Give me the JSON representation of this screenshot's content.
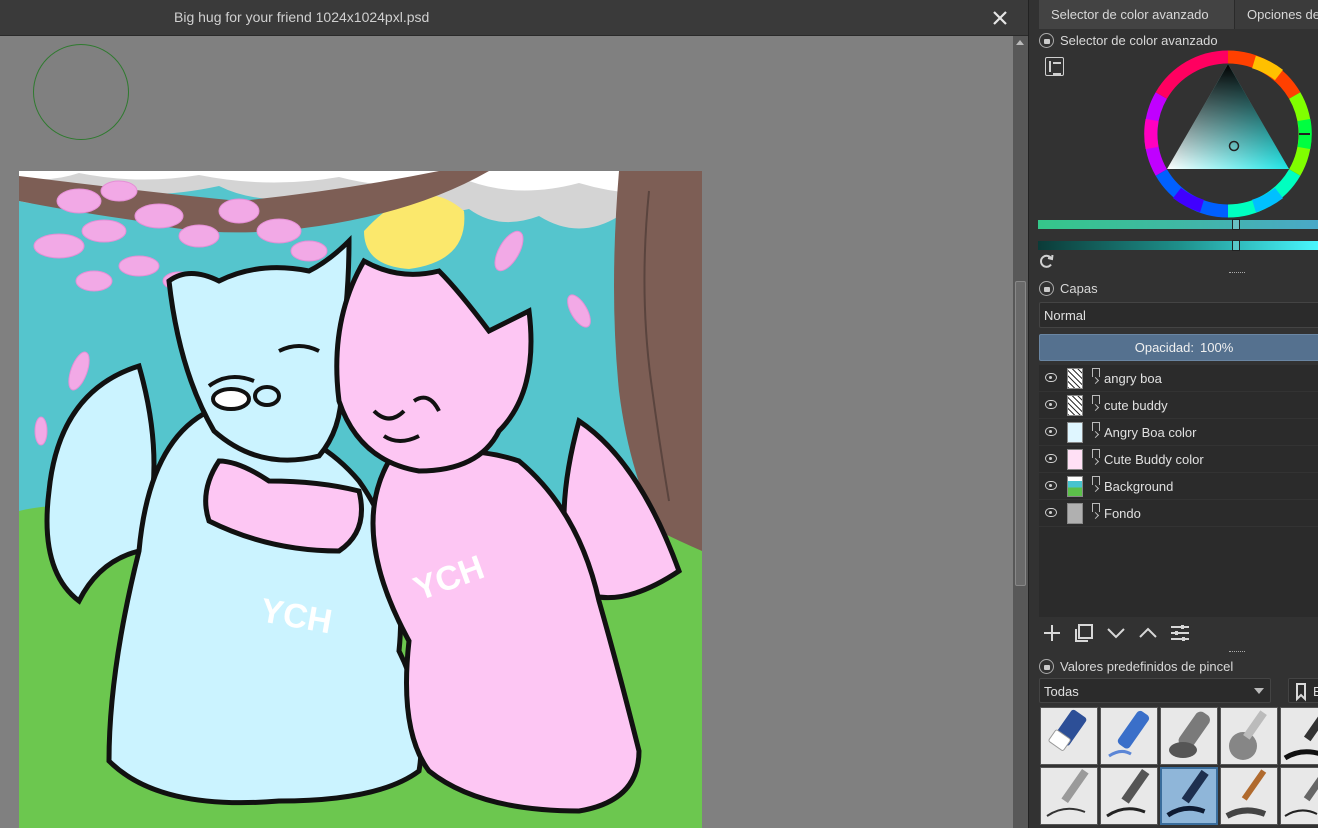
{
  "document": {
    "title": "Big hug for your friend 1024x1024pxl.psd"
  },
  "dock": {
    "tabs": [
      {
        "label": "Selector de color avanzado"
      },
      {
        "label": "Opciones de"
      }
    ],
    "color_selector": {
      "title": "Selector de color avanzado"
    },
    "layers_panel": {
      "title": "Capas",
      "blend_mode": "Normal",
      "opacity_label": "Opacidad:",
      "opacity_value": "100%",
      "layers": [
        {
          "name": "angry boa",
          "thumb": "lines"
        },
        {
          "name": "cute buddy",
          "thumb": "lines"
        },
        {
          "name": "Angry Boa color",
          "thumb": "blue"
        },
        {
          "name": "Cute Buddy color",
          "thumb": "pink"
        },
        {
          "name": "Background",
          "thumb": "bg"
        },
        {
          "name": "Fondo",
          "thumb": "grey"
        }
      ]
    },
    "brush_presets": {
      "title": "Valores predefinidos de pincel",
      "filter": "Todas",
      "tag_button": "E"
    }
  },
  "colors": {
    "accent": "#55718f",
    "selected_hsv": "#1ee5e6"
  }
}
